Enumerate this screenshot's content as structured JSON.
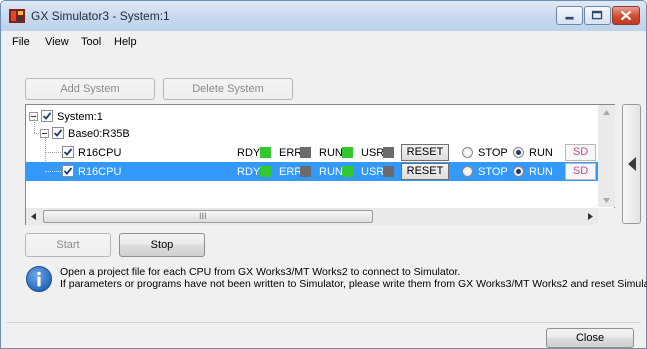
{
  "window": {
    "title": "GX Simulator3 - System:1"
  },
  "menu": [
    "File",
    "View",
    "Tool",
    "Help"
  ],
  "toolbar": {
    "add_system": "Add System",
    "delete_system": "Delete System"
  },
  "tree": {
    "system": "System:1",
    "base": "Base0:R35B",
    "cpus": [
      {
        "name": "R16CPU",
        "selected": false
      },
      {
        "name": "R16CPU",
        "selected": true
      }
    ],
    "status_labels": {
      "rdy": "RDY",
      "err": "ERR",
      "run": "RUN",
      "usr": "USR"
    },
    "reset_label": "RESET",
    "stop_label": "STOP",
    "run_label": "RUN",
    "sd_label": "SD",
    "scroll_marker": "III"
  },
  "controls": {
    "start": "Start",
    "stop": "Stop",
    "close": "Close"
  },
  "info": {
    "line1": "Open a project file for each CPU from GX Works3/MT Works2 to connect to Simulator.",
    "line2": "If parameters or programs have not been written to Simulator, please write them from GX Works3/MT Works2 and reset Simulator."
  },
  "colors": {
    "led_green": "#32c832",
    "led_gray": "#6b6b6b",
    "selection": "#3399ff"
  }
}
